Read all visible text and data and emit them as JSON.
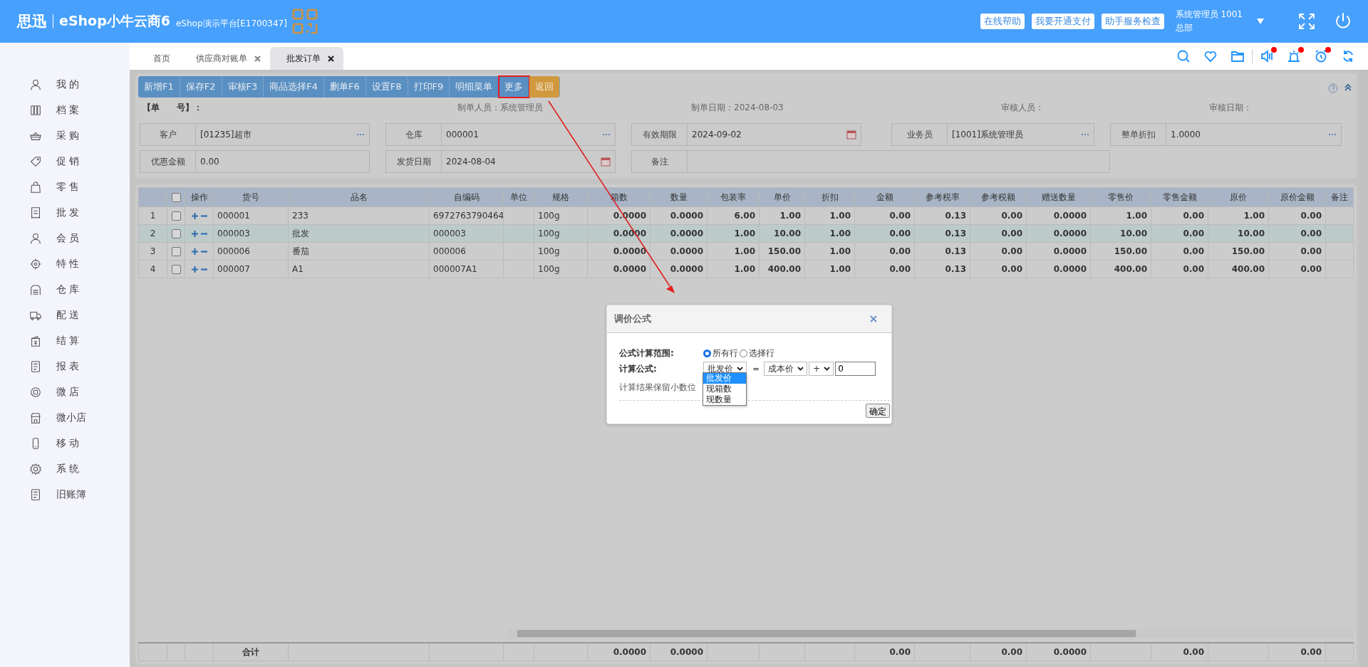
{
  "header": {
    "brand": "思迅",
    "product": "eShop小牛云商6",
    "platform": "eShop演示平台[E1700347]",
    "links": [
      "在线帮助",
      "我要开通支付",
      "助手服务检查"
    ],
    "user": "系统管理员 1001",
    "branch": "总部"
  },
  "sidebar": {
    "items": [
      {
        "label": "我 的"
      },
      {
        "label": "档 案"
      },
      {
        "label": "采 购"
      },
      {
        "label": "促 销"
      },
      {
        "label": "零 售"
      },
      {
        "label": "批 发"
      },
      {
        "label": "会 员"
      },
      {
        "label": "特 性"
      },
      {
        "label": "仓 库"
      },
      {
        "label": "配 送"
      },
      {
        "label": "结 算"
      },
      {
        "label": "报 表"
      },
      {
        "label": "微 店"
      },
      {
        "label": "微小店"
      },
      {
        "label": "移 动"
      },
      {
        "label": "系 统"
      },
      {
        "label": "旧账簿"
      }
    ]
  },
  "tabs": [
    {
      "label": "首页",
      "closable": false,
      "selected": false
    },
    {
      "label": "供应商对账单",
      "closable": true,
      "selected": false
    },
    {
      "label": "批发订单",
      "closable": true,
      "selected": true
    }
  ],
  "toolbar_icons": [
    {
      "dot": false
    },
    {
      "dot": false
    },
    {
      "dot": false
    },
    {
      "dot": true
    },
    {
      "dot": true
    },
    {
      "dot": true
    },
    {
      "dot": false
    }
  ],
  "actions": [
    {
      "label": "新增F1",
      "kind": "primary",
      "highlighted": false
    },
    {
      "label": "保存F2",
      "kind": "primary",
      "highlighted": false
    },
    {
      "label": "审核F3",
      "kind": "primary",
      "highlighted": false
    },
    {
      "label": "商品选择F4",
      "kind": "primary",
      "highlighted": false
    },
    {
      "label": "删单F6",
      "kind": "primary",
      "highlighted": false
    },
    {
      "label": "设置F8",
      "kind": "primary",
      "highlighted": false
    },
    {
      "label": "打印F9",
      "kind": "primary",
      "highlighted": false
    },
    {
      "label": "明细菜单",
      "kind": "primary",
      "highlighted": false
    },
    {
      "label": "更多",
      "kind": "primary",
      "highlighted": true
    },
    {
      "label": "返回",
      "kind": "warning",
      "highlighted": false
    }
  ],
  "info": [
    "【单　　号】：",
    "制单人员：系统管理员",
    "制单日期：2024-08-03",
    "审核人员：",
    "审核日期："
  ],
  "fields": [
    {
      "label": "客户",
      "value": "[01235]超市",
      "kind": "lookup"
    },
    {
      "label": "仓库",
      "value": "000001",
      "kind": "lookup"
    },
    {
      "label": "有效期限",
      "value": "2024-09-02",
      "kind": "date"
    },
    {
      "label": "业务员",
      "value": "[1001]系统管理员",
      "kind": "lookup"
    },
    {
      "label": "整单折扣",
      "value": "1.0000",
      "kind": "lookup"
    },
    {
      "label": "优惠金额",
      "value": "0.00",
      "kind": "plain"
    },
    {
      "label": "发货日期",
      "value": "2024-08-04",
      "kind": "date"
    },
    {
      "label": "备注",
      "kind": "wide"
    }
  ],
  "table": {
    "all_checked": false,
    "columns": [
      "操作",
      "货号",
      "品名",
      "自编码",
      "单位",
      "规格",
      "箱数",
      "数量",
      "包装率",
      "单价",
      "折扣",
      "金额",
      "参考税率",
      "参考税额",
      "赠送数量",
      "零售价",
      "零售金额",
      "原价",
      "原价金额",
      "备注"
    ],
    "rows": [
      {
        "index": "1",
        "checked": false,
        "selected": false,
        "code": "000001",
        "name": "233",
        "barcode": "6972763790464",
        "spec": "100g",
        "cases": "0.0000",
        "qty": "0.0000",
        "pack_rate": "6.00",
        "price": "1.00",
        "discount": "1.00",
        "amount": "0.00",
        "tax_rate": "0.13",
        "tax": "0.00",
        "gift_qty": "0.0000",
        "retail_price": "1.00",
        "retail_amount": "0.00",
        "orig_price": "1.00",
        "orig_amount": "0.00"
      },
      {
        "index": "2",
        "checked": false,
        "selected": true,
        "code": "000003",
        "name": "批发",
        "barcode": "000003",
        "spec": "100g",
        "cases": "0.0000",
        "qty": "0.0000",
        "pack_rate": "1.00",
        "price": "10.00",
        "discount": "1.00",
        "amount": "0.00",
        "tax_rate": "0.13",
        "tax": "0.00",
        "gift_qty": "0.0000",
        "retail_price": "10.00",
        "retail_amount": "0.00",
        "orig_price": "10.00",
        "orig_amount": "0.00"
      },
      {
        "index": "3",
        "checked": false,
        "selected": false,
        "code": "000006",
        "name": "番茄",
        "barcode": "000006",
        "spec": "100g",
        "cases": "0.0000",
        "qty": "0.0000",
        "pack_rate": "1.00",
        "price": "150.00",
        "discount": "1.00",
        "amount": "0.00",
        "tax_rate": "0.13",
        "tax": "0.00",
        "gift_qty": "0.0000",
        "retail_price": "150.00",
        "retail_amount": "0.00",
        "orig_price": "150.00",
        "orig_amount": "0.00"
      },
      {
        "index": "4",
        "checked": false,
        "selected": false,
        "code": "000007",
        "name": "A1",
        "barcode": "000007A1",
        "spec": "100g",
        "cases": "0.0000",
        "qty": "0.0000",
        "pack_rate": "1.00",
        "price": "400.00",
        "discount": "1.00",
        "amount": "0.00",
        "tax_rate": "0.13",
        "tax": "0.00",
        "gift_qty": "0.0000",
        "retail_price": "400.00",
        "retail_amount": "0.00",
        "orig_price": "400.00",
        "orig_amount": "0.00"
      }
    ],
    "totals": {
      "label": "合计",
      "cases": "0.0000",
      "qty": "0.0000",
      "amount": "0.00",
      "tax": "0.00",
      "gift_qty": "0.0000",
      "retail_amount": "0.00",
      "orig_amount": "0.00"
    }
  },
  "dialog": {
    "title": "调价公式",
    "scope_label": "公式计算范围:",
    "scope_options": [
      {
        "label": "所有行",
        "selected": true
      },
      {
        "label": "选择行",
        "selected": false
      }
    ],
    "formula_label": "计算公式:",
    "target": "批发价",
    "equals": "=",
    "source": "成本价",
    "operator": "+",
    "operand": "0",
    "hint": "计算结果保留小数位",
    "dropdown": [
      {
        "label": "批发价",
        "selected": true
      },
      {
        "label": "现箱数",
        "selected": false
      },
      {
        "label": "现数量",
        "selected": false
      }
    ],
    "confirm": "确定"
  }
}
